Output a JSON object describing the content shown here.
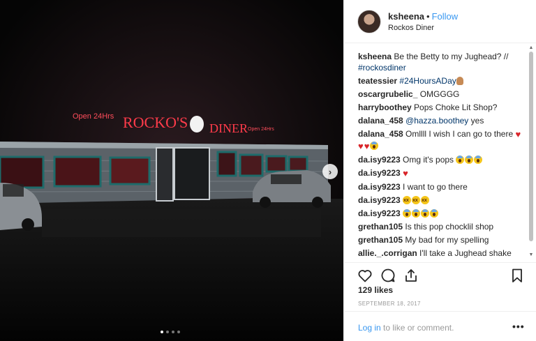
{
  "post": {
    "username": "ksheena",
    "separator": "•",
    "follow_label": "Follow",
    "location": "Rockos Diner",
    "likes": "129 likes",
    "date": "SEPTEMBER 18, 2017",
    "login_link": "Log in",
    "login_text": " to like or comment.",
    "more_label": "•••"
  },
  "media": {
    "sign_open_left": "Open 24Hrs",
    "sign_rockos": "ROCKO'S",
    "sign_diner": "DINER",
    "sign_open_right": "Open 24Hrs",
    "next_label": "›",
    "slides": 4,
    "active_slide": 0
  },
  "comments": [
    {
      "author": "ksheena",
      "parts": [
        {
          "t": "text",
          "v": " Be the Betty to my Jughead? // "
        },
        {
          "t": "link",
          "v": "#rockosdiner"
        }
      ]
    },
    {
      "author": "teatessier",
      "parts": [
        {
          "t": "text",
          "v": " "
        },
        {
          "t": "link",
          "v": "#24HoursADay"
        },
        {
          "t": "emoji",
          "v": "ok-hand"
        }
      ]
    },
    {
      "author": "oscargrubelic_",
      "parts": [
        {
          "t": "text",
          "v": " OMGGGG"
        }
      ]
    },
    {
      "author": "harryboothey",
      "parts": [
        {
          "t": "text",
          "v": " Pops Choke Lit Shop?"
        }
      ]
    },
    {
      "author": "dalana_458",
      "parts": [
        {
          "t": "text",
          "v": " "
        },
        {
          "t": "link",
          "v": "@hazza.boothey"
        },
        {
          "t": "text",
          "v": " yes"
        }
      ]
    },
    {
      "author": "dalana_458",
      "parts": [
        {
          "t": "text",
          "v": " Omllll I wish I can go to there "
        },
        {
          "t": "emoji",
          "v": "heart"
        },
        {
          "t": "emoji",
          "v": "heart"
        },
        {
          "t": "emoji",
          "v": "heart"
        },
        {
          "t": "emoji",
          "v": "scream"
        }
      ]
    },
    {
      "author": "da.isy9223",
      "parts": [
        {
          "t": "text",
          "v": " Omg it's pops "
        },
        {
          "t": "emoji",
          "v": "scream"
        },
        {
          "t": "emoji",
          "v": "scream"
        },
        {
          "t": "emoji",
          "v": "scream"
        }
      ]
    },
    {
      "author": "da.isy9223",
      "parts": [
        {
          "t": "text",
          "v": " "
        },
        {
          "t": "emoji",
          "v": "heart"
        }
      ]
    },
    {
      "author": "da.isy9223",
      "parts": [
        {
          "t": "text",
          "v": " I want to go there"
        }
      ]
    },
    {
      "author": "da.isy9223",
      "parts": [
        {
          "t": "text",
          "v": " "
        },
        {
          "t": "emoji",
          "v": "tired"
        },
        {
          "t": "emoji",
          "v": "tired"
        },
        {
          "t": "emoji",
          "v": "tired"
        }
      ]
    },
    {
      "author": "da.isy9223",
      "parts": [
        {
          "t": "text",
          "v": " "
        },
        {
          "t": "emoji",
          "v": "scream"
        },
        {
          "t": "emoji",
          "v": "scream"
        },
        {
          "t": "emoji",
          "v": "scream"
        },
        {
          "t": "emoji",
          "v": "scream"
        }
      ]
    },
    {
      "author": "grethan105",
      "parts": [
        {
          "t": "text",
          "v": " Is this pop chocklil shop"
        }
      ]
    },
    {
      "author": "grethan105",
      "parts": [
        {
          "t": "text",
          "v": " My bad for my spelling"
        }
      ]
    },
    {
      "author": "allie._.corrigan",
      "parts": [
        {
          "t": "text",
          "v": " I'll take a Jughead shake"
        }
      ]
    }
  ],
  "icons": {
    "like": "heart-outline-icon",
    "comment": "comment-bubble-icon",
    "share": "share-icon",
    "save": "bookmark-icon",
    "next": "chevron-right-icon"
  },
  "colors": {
    "link": "#003569",
    "follow": "#3897f0",
    "neon": "#ff3b4a",
    "border": "#efefef"
  }
}
